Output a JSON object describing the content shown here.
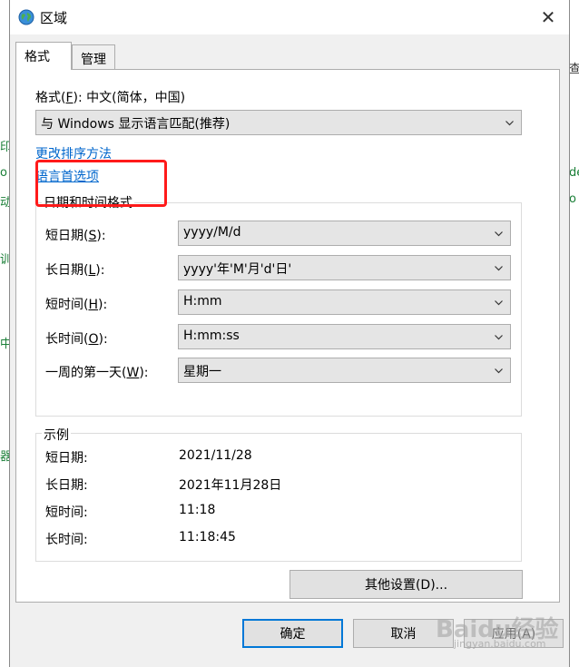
{
  "window": {
    "title": "区域",
    "close_glyph": "✕"
  },
  "tabs": [
    {
      "label": "格式",
      "active": true
    },
    {
      "label": "管理",
      "active": false
    }
  ],
  "format": {
    "label_prefix": "格式(",
    "label_key": "F",
    "label_suffix": "): 中文(简体，中国)",
    "selected": "与 Windows 显示语言匹配(推荐)"
  },
  "links": {
    "change_sort": "更改排序方法",
    "language_prefs": "语言首选项"
  },
  "datetime_group": {
    "title": "日期和时间格式",
    "rows": [
      {
        "label_pre": "短日期(",
        "key": "S",
        "label_post": "):",
        "value": "yyyy/M/d"
      },
      {
        "label_pre": "长日期(",
        "key": "L",
        "label_post": "):",
        "value": "yyyy'年'M'月'd'日'"
      },
      {
        "label_pre": "短时间(",
        "key": "H",
        "label_post": "):",
        "value": "H:mm"
      },
      {
        "label_pre": "长时间(",
        "key": "O",
        "label_post": "):",
        "value": "H:mm:ss"
      },
      {
        "label_pre": "一周的第一天(",
        "key": "W",
        "label_post": "):",
        "value": "星期一"
      }
    ]
  },
  "example_group": {
    "title": "示例",
    "rows": [
      {
        "label": "短日期:",
        "value": "2021/11/28"
      },
      {
        "label": "长日期:",
        "value": "2021年11月28日"
      },
      {
        "label": "短时间:",
        "value": "11:18"
      },
      {
        "label": "长时间:",
        "value": "11:18:45"
      }
    ]
  },
  "buttons": {
    "other_settings": "其他设置(D)...",
    "ok": "确定",
    "cancel": "取消",
    "apply": "应用(A)"
  },
  "watermark": {
    "brand": "Baidu经验",
    "sub": "jingyan.baidu.com"
  },
  "background_fragments": [
    "印",
    "o",
    "动",
    "训",
    "中",
    "器",
    "查",
    "de",
    "o"
  ],
  "colors": {
    "link": "#0066cc",
    "highlight_box": "#ff1a1a",
    "default_button_border": "#0078d7"
  }
}
